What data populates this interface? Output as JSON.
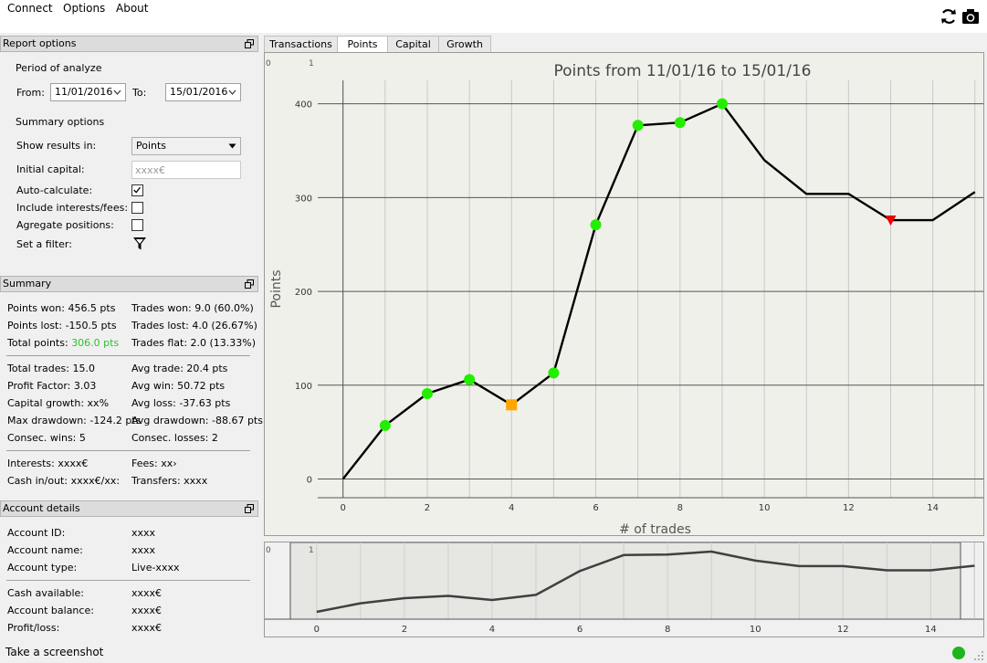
{
  "menu": {
    "connect": "Connect",
    "options": "Options",
    "about": "About"
  },
  "toolbar": {
    "refresh_icon": "refresh-icon",
    "screenshot_icon": "camera-icon"
  },
  "report_options": {
    "header": "Report options",
    "period_label": "Period of analyze",
    "from_label": "From:",
    "from_value": "11/01/2016",
    "to_label": "To:",
    "to_value": "15/01/2016",
    "summary_options_label": "Summary options",
    "show_results_label": "Show results in:",
    "show_results_value": "Points",
    "initial_capital_label": "Initial capital:",
    "initial_capital_placeholder": "xxxx€",
    "auto_calculate_label": "Auto-calculate:",
    "auto_calculate_checked": true,
    "include_interests_label": "Include interests/fees:",
    "include_interests_checked": false,
    "aggregate_label": "Agregate positions:",
    "aggregate_checked": false,
    "filter_label": "Set a filter:"
  },
  "summary": {
    "header": "Summary",
    "points_won": "Points won: 456.5 pts",
    "points_lost": "Points lost: -150.5 pts",
    "total_points_label": "Total points: ",
    "total_points_value": "306.0 pts",
    "trades_won": "Trades won: 9.0 (60.0%)",
    "trades_lost": "Trades lost: 4.0 (26.67%)",
    "trades_flat": "Trades flat: 2.0 (13.33%)",
    "total_trades": "Total trades: 15.0",
    "profit_factor": "Profit Factor: 3.03",
    "capital_growth": "Capital growth: xx%",
    "max_drawdown": "Max drawdown: -124.2 pts",
    "consec_wins": "Consec. wins: 5",
    "avg_trade": "Avg trade: 20.4 pts",
    "avg_win": "Avg win: 50.72 pts",
    "avg_loss": "Avg loss: -37.63 pts",
    "avg_drawdown": "Avg drawdown: -88.67 pts",
    "consec_losses": "Consec. losses: 2",
    "interests": "Interests: xxxx€",
    "cash_in_out": "Cash in/out: xxxx€/xx:",
    "fees": "Fees: xx›",
    "transfers": "Transfers: xxxx"
  },
  "account": {
    "header": "Account details",
    "rows": [
      {
        "label": "Account ID:",
        "value": "xxxx"
      },
      {
        "label": "Account name:",
        "value": "xxxx"
      },
      {
        "label": "Account type:",
        "value": "Live-xxxx"
      },
      {
        "label": "Cash available:",
        "value": "xxxx€"
      },
      {
        "label": "Account balance:",
        "value": "xxxx€"
      },
      {
        "label": "Profit/loss:",
        "value": "xxxx€"
      }
    ]
  },
  "tabs": [
    {
      "label": "Transactions",
      "active": false
    },
    {
      "label": "Points",
      "active": true
    },
    {
      "label": "Capital",
      "active": false
    },
    {
      "label": "Growth",
      "active": false
    }
  ],
  "status": {
    "text": "Take a screenshot",
    "connection_color": "#1db41d"
  },
  "chart_data": {
    "type": "line",
    "title": "Points from 11/01/16 to 15/01/16",
    "xlabel": "# of trades",
    "ylabel": "Points",
    "xlim": [
      -0.6,
      15.2
    ],
    "ylim": [
      -20,
      425
    ],
    "xticks": [
      0,
      2,
      4,
      6,
      8,
      10,
      12,
      14
    ],
    "yticks": [
      0,
      100,
      200,
      300,
      400
    ],
    "grid": true,
    "corner_labels": [
      "0",
      "1"
    ],
    "line_color": "#000000",
    "x": [
      0,
      1,
      2,
      3,
      4,
      5,
      6,
      7,
      8,
      9,
      10,
      11,
      12,
      13,
      14,
      15
    ],
    "y": [
      0,
      57,
      91,
      106,
      79,
      113,
      271,
      377,
      380,
      400,
      340,
      304,
      304,
      276,
      276,
      306
    ],
    "markers": [
      {
        "x": 1,
        "y": 57,
        "kind": "win",
        "color": "#22ee00"
      },
      {
        "x": 2,
        "y": 91,
        "kind": "win",
        "color": "#22ee00"
      },
      {
        "x": 3,
        "y": 106,
        "kind": "win",
        "color": "#22ee00"
      },
      {
        "x": 4,
        "y": 79,
        "kind": "flat",
        "color": "#ffa500"
      },
      {
        "x": 5,
        "y": 113,
        "kind": "win",
        "color": "#22ee00"
      },
      {
        "x": 6,
        "y": 271,
        "kind": "win",
        "color": "#22ee00"
      },
      {
        "x": 7,
        "y": 377,
        "kind": "win",
        "color": "#22ee00"
      },
      {
        "x": 8,
        "y": 380,
        "kind": "win",
        "color": "#22ee00"
      },
      {
        "x": 9,
        "y": 400,
        "kind": "win",
        "color": "#22ee00"
      },
      {
        "x": 13,
        "y": 276,
        "kind": "loss",
        "color": "#ee0000"
      }
    ]
  },
  "navigator_data": {
    "type": "line",
    "xticks": [
      0,
      2,
      4,
      6,
      8,
      10,
      12,
      14
    ],
    "corner_labels": [
      "0",
      "1"
    ],
    "line_color": "#404040",
    "xlim": [
      -0.6,
      15.2
    ],
    "window_range": [
      -0.6,
      15.2
    ]
  }
}
